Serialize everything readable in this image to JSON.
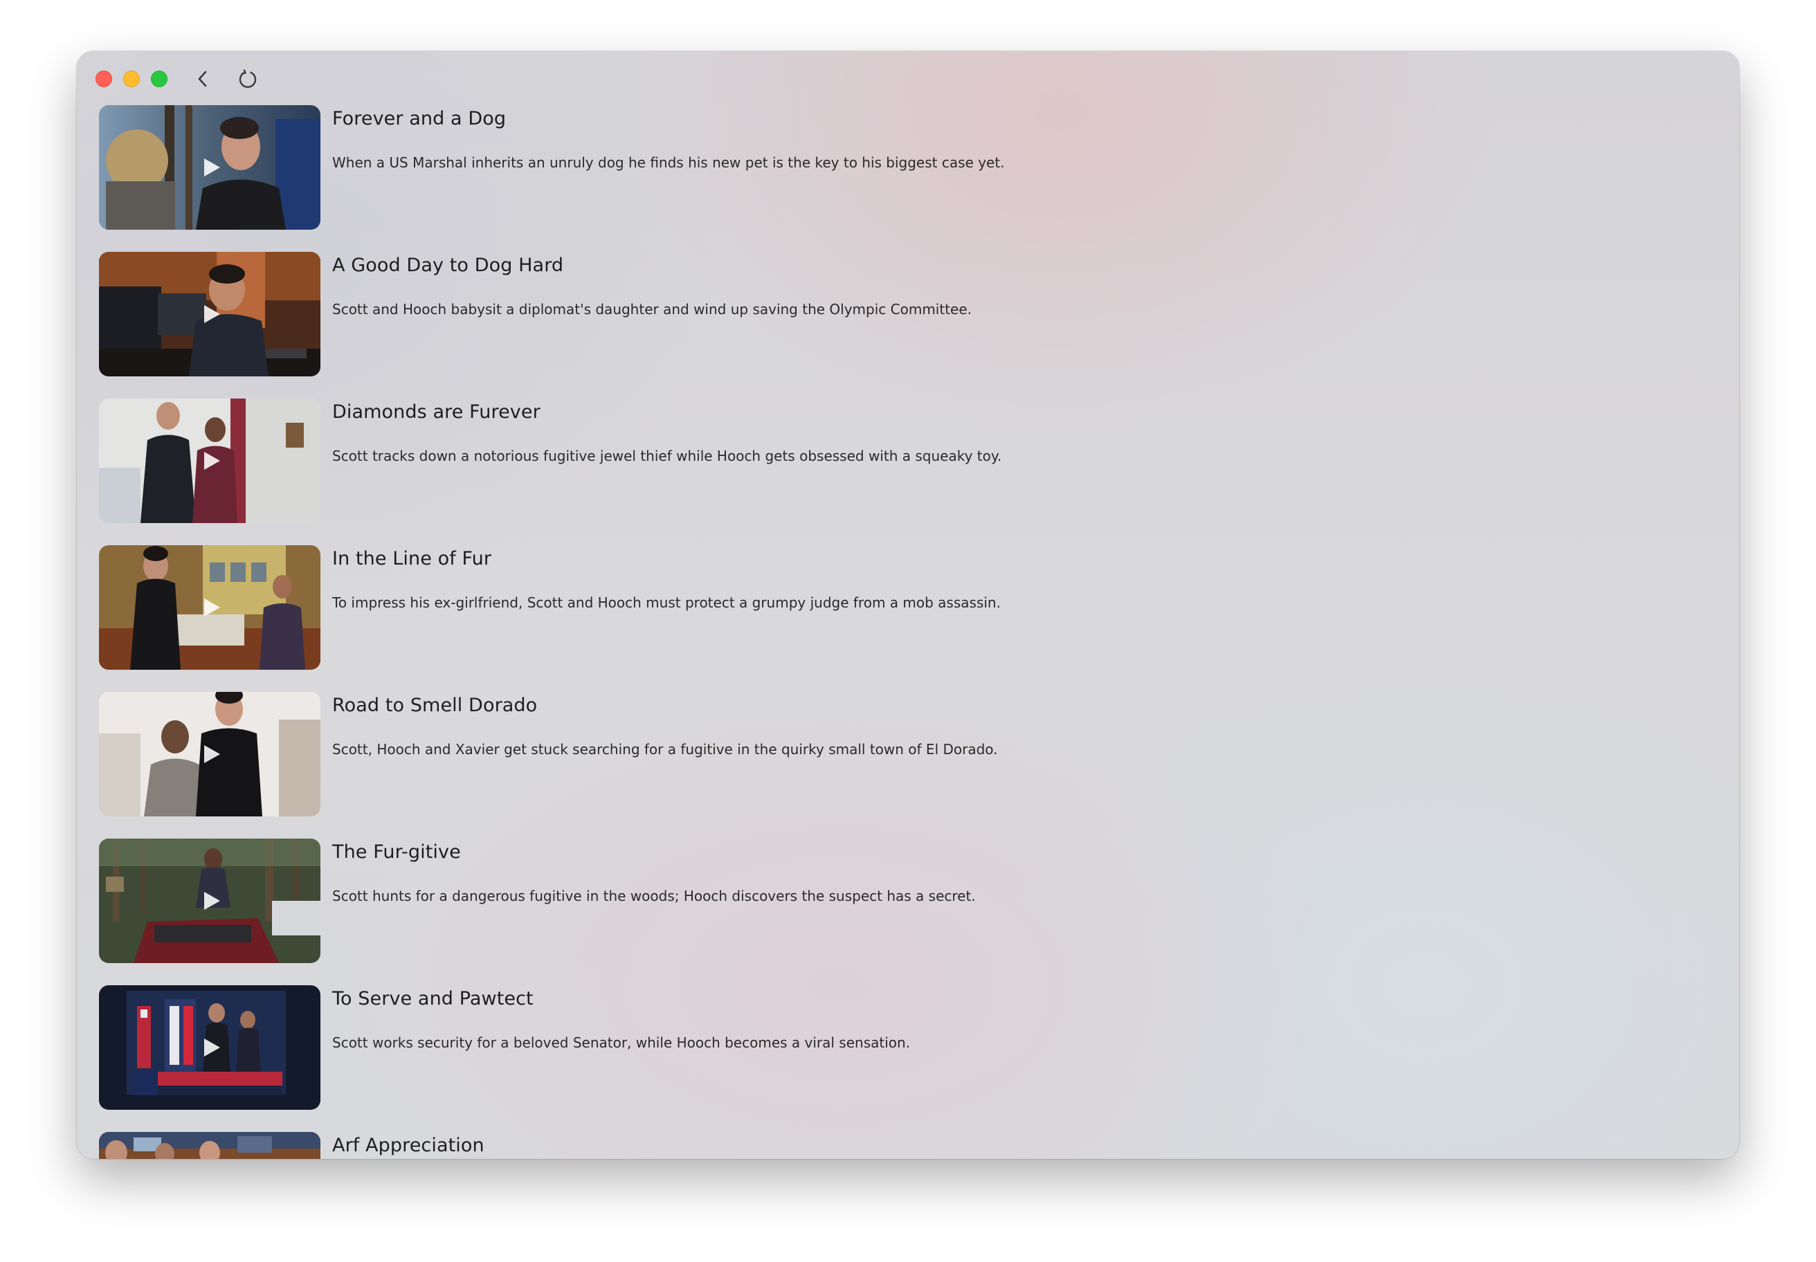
{
  "window": {
    "controls": {
      "close_icon": "close-traffic-light",
      "minimize_icon": "minimize-traffic-light",
      "maximize_icon": "maximize-traffic-light",
      "back_icon": "chevron-left-icon",
      "reload_icon": "reload-icon"
    },
    "colors": {
      "close": "#fe5f57",
      "minimize": "#febc2e",
      "maximize": "#28c840",
      "text": "#1e1e1e"
    }
  },
  "episodes": [
    {
      "title": "Forever and a Dog",
      "description": "When a US Marshal inherits an unruly dog he finds his new pet is the key to his biggest case yet."
    },
    {
      "title": "A Good Day to Dog Hard",
      "description": "Scott and Hooch babysit a diplomat's daughter and wind up saving the Olympic Committee."
    },
    {
      "title": "Diamonds are Furever",
      "description": "Scott tracks down a notorious fugitive jewel thief while Hooch gets obsessed with a squeaky toy."
    },
    {
      "title": "In the Line of Fur",
      "description": "To impress his ex-girlfriend, Scott and Hooch must protect a grumpy judge from a mob assassin."
    },
    {
      "title": "Road to Smell Dorado",
      "description": "Scott, Hooch and Xavier get stuck searching for a fugitive in the quirky small town of El Dorado."
    },
    {
      "title": "The Fur-gitive",
      "description": "Scott hunts for a dangerous fugitive in the woods; Hooch discovers the suspect has a secret."
    },
    {
      "title": "To Serve and Pawtect",
      "description": "Scott works security for a beloved Senator, while Hooch becomes a viral sensation."
    },
    {
      "title": "Arf Appreciation",
      "description": ""
    }
  ]
}
